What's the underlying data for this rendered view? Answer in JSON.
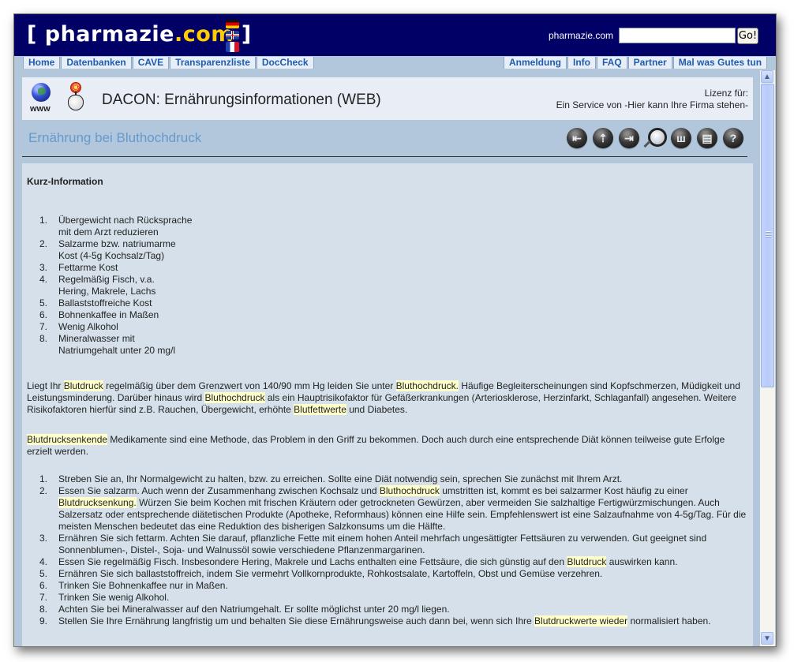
{
  "header": {
    "logo": {
      "bracket_open": "[",
      "name": "pharmazie",
      "dot_com": ".com",
      "bracket_close": "]"
    },
    "languages": [
      "german-flag",
      "uk-flag",
      "french-flag"
    ],
    "search": {
      "label": "pharmazie.com",
      "value": "",
      "placeholder": "",
      "button": "Go!"
    }
  },
  "nav": {
    "left": [
      "Home",
      "Datenbanken",
      "CAVE",
      "Transparenzliste",
      "DocCheck"
    ],
    "right": [
      "Anmeldung",
      "Info",
      "FAQ",
      "Partner",
      "Mal was Gutes tun"
    ]
  },
  "dacon": {
    "icons": [
      "globe-icon",
      "at-icon",
      "apple-icon"
    ],
    "www_label": "www",
    "title": "DACON: Ernährungsinformationen (WEB)",
    "license_label": "Lizenz für:",
    "license_value": "Ein Service von -Hier kann Ihre Firma stehen-"
  },
  "page": {
    "title": "Ernährung bei Bluthochdruck",
    "toolbar": [
      {
        "name": "back-icon",
        "glyph": "⇤"
      },
      {
        "name": "up-icon",
        "glyph": "⇡"
      },
      {
        "name": "forward-icon",
        "glyph": "⇥"
      },
      {
        "name": "search-icon",
        "glyph": ""
      },
      {
        "name": "sitemap-icon",
        "glyph": "ш"
      },
      {
        "name": "print-icon",
        "glyph": "▤"
      },
      {
        "name": "help-icon",
        "glyph": "?"
      }
    ]
  },
  "content": {
    "kurz_heading": "Kurz-Information",
    "short_list": [
      [
        "Übergewicht nach Rücksprache",
        "mit dem Arzt reduzieren"
      ],
      [
        "Salzarme bzw. natriumarme",
        "Kost (4-5g Kochsalz/Tag)"
      ],
      [
        "Fettarme Kost"
      ],
      [
        "Regelmäßig Fisch, v.a.",
        "Hering, Makrele, Lachs"
      ],
      [
        "Ballaststoffreiche Kost"
      ],
      [
        "Bohnenkaffee in Maßen"
      ],
      [
        "Wenig Alkohol"
      ],
      [
        "Mineralwasser mit",
        "Natriumgehalt unter 20 mg/l"
      ]
    ],
    "para1": [
      {
        "t": "Liegt Ihr "
      },
      {
        "t": "Blutdruck",
        "hl": true
      },
      {
        "t": " regelmäßig über dem Grenzwert von 140/90 mm Hg leiden Sie unter "
      },
      {
        "t": "Bluthochdruck.",
        "hl": true
      },
      {
        "t": " Häufige Begleiterscheinungen sind Kopfschmerzen, Müdigkeit und Leistungsminderung. Darüber hinaus wird "
      },
      {
        "t": "Bluthochdruck",
        "hl": true
      },
      {
        "t": " als ein Hauptrisikofaktor für Gefäßerkrankungen  (Arteriosklerose, Herzinfarkt, Schlaganfall) angesehen. Weitere Risikofaktoren hierfür sind z.B. Rauchen, Übergewicht, erhöhte "
      },
      {
        "t": "Blutfettwerte",
        "hl": true
      },
      {
        "t": " und Diabetes."
      }
    ],
    "para2": [
      {
        "t": "Blutdrucksenkende",
        "hl": true
      },
      {
        "t": " Medikamente sind eine Methode, das Problem in den Griff zu bekommen. Doch auch durch eine entsprechende Diät können teilweise gute Erfolge erzielt werden."
      }
    ],
    "long_list": [
      [
        {
          "t": "Streben Sie an, Ihr Normalgewicht zu halten, bzw. zu erreichen. Sollte eine Diät notwendig sein, sprechen Sie zunächst mit Ihrem Arzt."
        }
      ],
      [
        {
          "t": "Essen Sie salzarm. Auch wenn der Zusammenhang zwischen Kochsalz und "
        },
        {
          "t": "Bluthochdruck",
          "hl": true
        },
        {
          "t": " umstritten ist, kommt es bei salzarmer Kost häufig zu einer "
        },
        {
          "t": "Blutdrucksenkung.",
          "hl": true
        },
        {
          "t": " Würzen Sie beim Kochen mit frischen Kräutern oder getrockneten Gewürzen, aber vermeiden Sie salzhaltige Fertigwürzmischungen. Auch Salzersatz oder entsprechende diätetischen Produkte (Apotheke, Reformhaus) können eine Hilfe sein. Empfehlenswert ist eine Salzaufnahme von 4-5g/Tag. Für die meisten Menschen bedeutet das eine Reduktion des bisherigen Salzkonsums um die Hälfte."
        }
      ],
      [
        {
          "t": "Ernähren Sie sich fettarm. Achten Sie darauf, pflanzliche Fette mit einem hohen Anteil mehrfach ungesättigter Fettsäuren zu verwenden. Gut geeignet sind Sonnenblumen-, Distel-, Soja- und Walnussöl sowie verschiedene Pflanzenmargarinen."
        }
      ],
      [
        {
          "t": "Essen Sie regelmäßig Fisch. Insbesondere Hering, Makrele und Lachs enthalten eine Fettsäure, die sich günstig auf den "
        },
        {
          "t": "Blutdruck",
          "hl": true
        },
        {
          "t": " auswirken kann."
        }
      ],
      [
        {
          "t": "Ernähren Sie sich ballaststoffreich, indem Sie vermehrt Vollkornprodukte, Rohkostsalate, Kartoffeln, Obst und Gemüse verzehren."
        }
      ],
      [
        {
          "t": "Trinken Sie Bohnenkaffee nur in Maßen."
        }
      ],
      [
        {
          "t": "Trinken Sie wenig Alkohol."
        }
      ],
      [
        {
          "t": "Achten Sie bei Mineralwasser auf den Natriumgehalt. Er sollte möglichst unter 20 mg/l liegen."
        }
      ],
      [
        {
          "t": "Stellen Sie Ihre Ernährung langfristig um und behalten Sie diese Ernährungsweise auch dann bei, wenn sich Ihre "
        },
        {
          "t": "Blutdruckwerte wieder",
          "hl": true
        },
        {
          "t": " normalisiert haben."
        }
      ]
    ]
  },
  "scrollbar": {
    "up": "⌃",
    "down": "⌄",
    "position_fraction": 0.0
  },
  "colors": {
    "header_bg": "#000066",
    "logo_dot_com": "#ffcc00",
    "nav_text": "#1e5cb3",
    "page_title": "#6699cc",
    "highlight": "#ffffcc",
    "content_bg": "#d5e0eb"
  }
}
